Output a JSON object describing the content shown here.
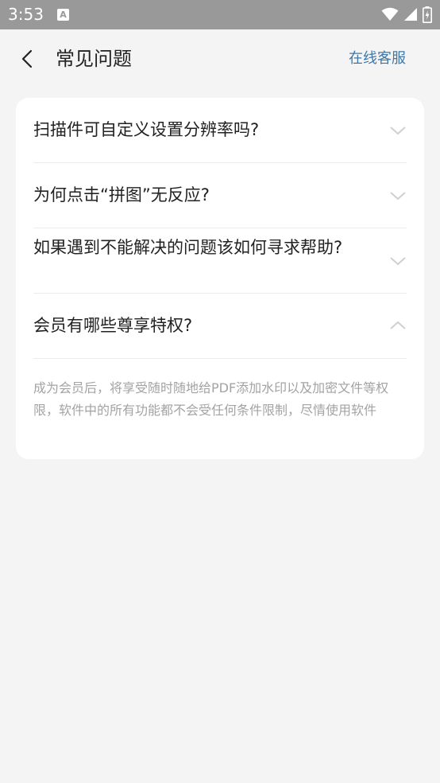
{
  "status_bar": {
    "time": "3:53",
    "notification_icon_letter": "A",
    "icons": [
      "wifi-icon",
      "signal-icon",
      "battery-icon"
    ]
  },
  "header": {
    "title": "常见问题",
    "action_label": "在线客服",
    "back_icon": "chevron-left-icon"
  },
  "faq": {
    "items": [
      {
        "question": "扫描件可自定义设置分辨率吗?",
        "expanded": false
      },
      {
        "question": "为何点击“拼图”无反应?",
        "expanded": false
      },
      {
        "question": "如果遇到不能解决的问题该如何寻求帮助?",
        "expanded": false
      },
      {
        "question": "会员有哪些尊享特权?",
        "expanded": true
      }
    ],
    "answer": "成为会员后，将享受随时随地给PDF添加水印以及加密文件等权限，软件中的所有功能都不会受任何条件限制，尽情使用软件"
  },
  "colors": {
    "status_bar_bg": "#999999",
    "page_bg": "#f4f4f4",
    "card_bg": "#ffffff",
    "accent": "#3f78a8",
    "answer_text": "#a3a3a3"
  }
}
